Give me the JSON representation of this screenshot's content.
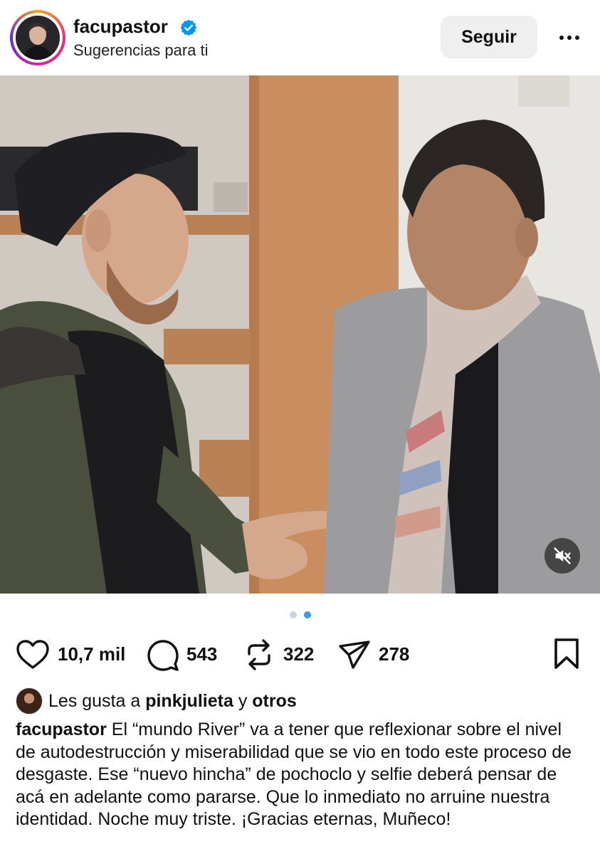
{
  "post": {
    "username": "facupastor",
    "verified": true,
    "subtitle": "Sugerencias para ti",
    "follow_label": "Seguir",
    "more_icon": "more-horizontal-icon"
  },
  "media": {
    "carousel_count": 2,
    "carousel_active": 2,
    "muted": true,
    "colors": {
      "dot_active": "#3897f0",
      "dot_inactive": "#c7d3e3"
    }
  },
  "actions": {
    "likes_count": "10,7 mil",
    "comments_count": "543",
    "reposts_count": "322",
    "shares_count": "278"
  },
  "liked_by": {
    "prefix": "Les gusta a",
    "user": "pinkjulieta",
    "connector": "y",
    "others": "otros"
  },
  "caption": {
    "user": "facupastor",
    "text": "El “mundo River” va a tener que reflexionar sobre el nivel de autodestrucción y miserabilidad que se vio en todo este proceso de desgaste. Ese “nuevo hincha” de pochoclo y selfie deberá pensar de acá en adelante como pararse. Que lo inmediato no arruine nuestra identidad. Noche muy triste. ¡Gracias eternas, Muñeco!"
  },
  "colors": {
    "verified_blue": "#0095f6",
    "text": "#111111",
    "button_bg": "#efefef"
  }
}
